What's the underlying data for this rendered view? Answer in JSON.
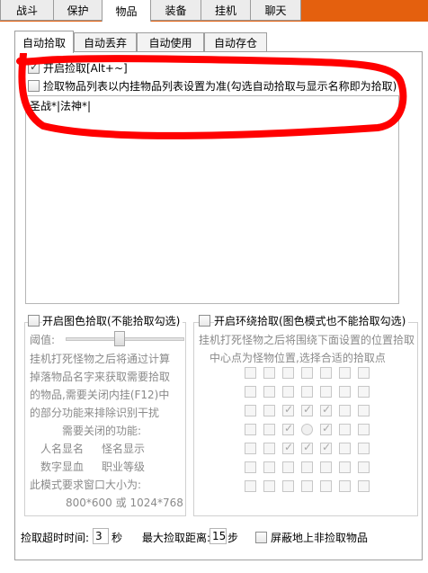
{
  "top_tabs": [
    {
      "label": "战斗"
    },
    {
      "label": "保护"
    },
    {
      "label": "物品"
    },
    {
      "label": "装备"
    },
    {
      "label": "挂机"
    },
    {
      "label": "聊天"
    }
  ],
  "sub_tabs": [
    {
      "label": "自动拾取"
    },
    {
      "label": "自动丢弃"
    },
    {
      "label": "自动使用"
    },
    {
      "label": "自动存仓"
    }
  ],
  "pickup": {
    "enable_label": "开启捡取[Alt+~]",
    "list_option_label": "捡取物品列表以内挂物品列表设置为准(勾选自动拾取与显示名称即为拾取)",
    "list_text": "圣战*|法神*|"
  },
  "color_pickup": {
    "title": "开启图色拾取(不能拾取勾选)",
    "threshold_label": "阈值:",
    "threshold_value": 0.45,
    "desc_lines": [
      "挂机打死怪物之后将通过计算",
      "掉落物品名字来获取需要拾取",
      "的物品,需要关闭内挂(F12)中",
      "的部分功能来排除识别干扰"
    ],
    "need_close_label": "需要关闭的功能:",
    "features": [
      "人名显名",
      "怪名显示",
      "数字显血",
      "职业等级"
    ],
    "window_req_label": "此模式要求窗口大小为:",
    "window_sizes": "800*600 或 1024*768"
  },
  "ring_pickup": {
    "title": "开启环绕拾取(图色模式也不能拾取勾选)",
    "desc_line1": "挂机打死怪物之后将围绕下面设置的位置拾取",
    "desc_line2": "中心点为怪物位置,选择合适的拾取点",
    "grid": [
      [
        0,
        0,
        0,
        0,
        0,
        0,
        0
      ],
      [
        0,
        0,
        0,
        0,
        0,
        0,
        0
      ],
      [
        0,
        0,
        1,
        1,
        1,
        0,
        0
      ],
      [
        0,
        0,
        1,
        2,
        1,
        0,
        0
      ],
      [
        0,
        0,
        1,
        1,
        1,
        0,
        0
      ],
      [
        0,
        0,
        0,
        0,
        0,
        0,
        0
      ],
      [
        0,
        0,
        0,
        0,
        0,
        0,
        0
      ]
    ]
  },
  "bottom": {
    "timeout_label": "捡取超时时间:",
    "timeout_value": "3",
    "timeout_unit": "秒",
    "distance_label": "最大捡取距离:",
    "distance_value": "15",
    "distance_unit": "步",
    "hide_label": "屏蔽地上非捡取物品"
  },
  "colors": {
    "top_bar": "#e4600e",
    "annotation": "#ff0000"
  }
}
